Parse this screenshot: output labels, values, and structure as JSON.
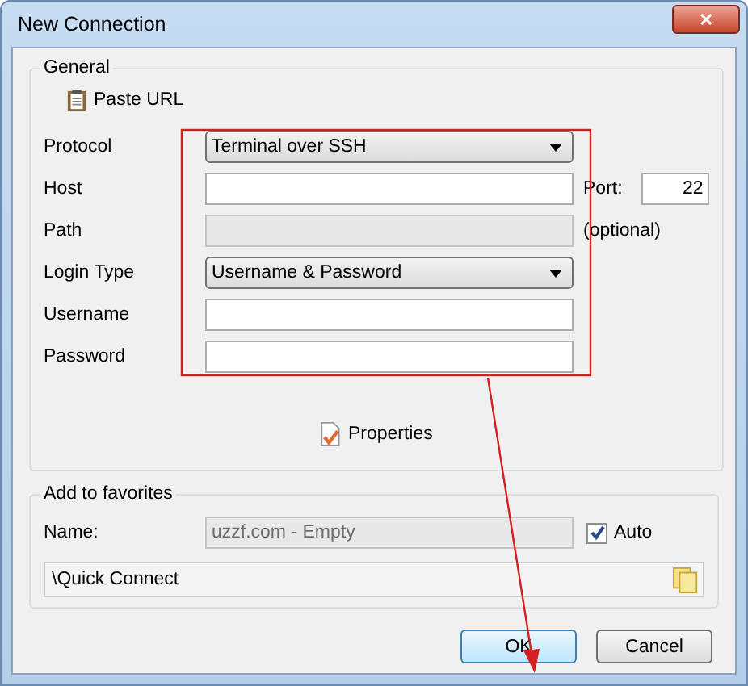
{
  "window": {
    "title": "New Connection",
    "close": "✕"
  },
  "general": {
    "title": "General",
    "paste_url": "Paste URL",
    "rows": [
      {
        "kind": "select",
        "label": "Protocol",
        "value": "Terminal over SSH"
      },
      {
        "kind": "input",
        "label": "Host",
        "value": "",
        "disabled": false,
        "extra_label": "Port:",
        "extra_value": "22"
      },
      {
        "kind": "input",
        "label": "Path",
        "value": "",
        "disabled": true,
        "note": "(optional)"
      },
      {
        "kind": "select",
        "label": "Login Type",
        "value": "Username & Password"
      },
      {
        "kind": "input",
        "label": "Username",
        "value": "",
        "disabled": false
      },
      {
        "kind": "input",
        "label": "Password",
        "value": "",
        "disabled": false
      }
    ],
    "properties": "Properties"
  },
  "favorites": {
    "title": "Add to favorites",
    "name_label": "Name:",
    "name_value": "uzzf.com - Empty",
    "name_disabled": true,
    "auto": {
      "label": "Auto",
      "checked": true
    },
    "folder": "\\Quick Connect"
  },
  "buttons": [
    {
      "label": "OK",
      "default": true
    },
    {
      "label": "Cancel",
      "default": false
    }
  ]
}
